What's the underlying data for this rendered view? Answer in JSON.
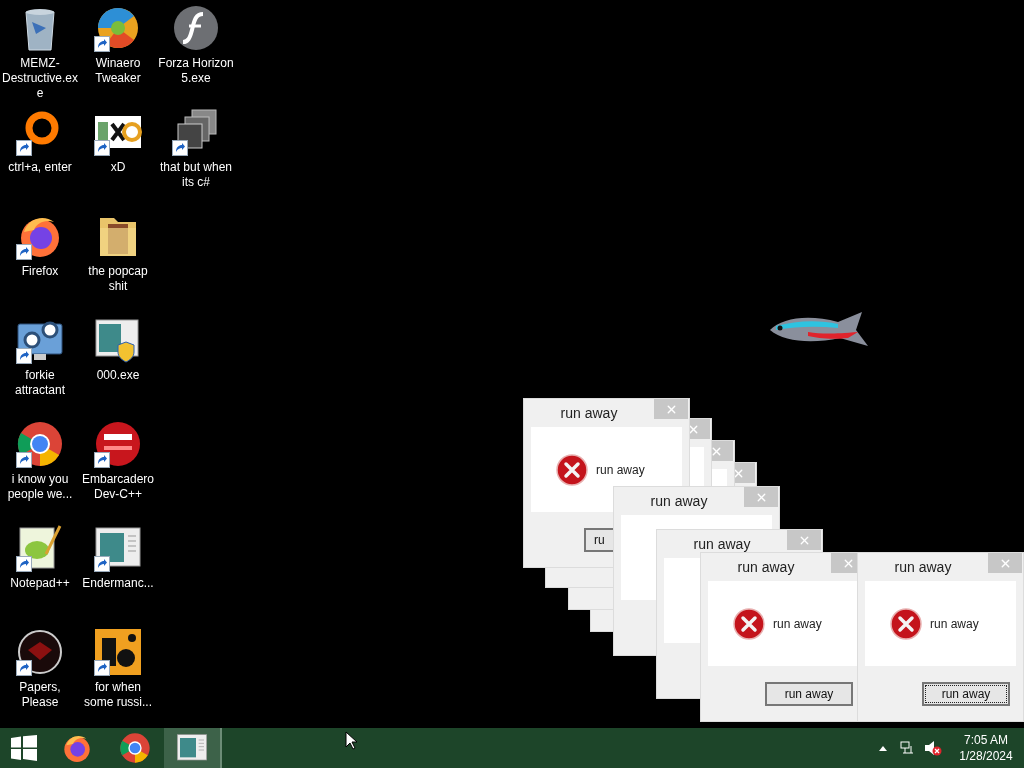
{
  "desktop": {
    "icon_rows": [
      [
        {
          "label": "MEMZ-Destructive.exe",
          "kind": "bin",
          "shortcut": false
        },
        {
          "label": "Winaero Tweaker",
          "kind": "swirl",
          "shortcut": true
        },
        {
          "label": "Forza Horizon 5.exe",
          "kind": "flash",
          "shortcut": false
        }
      ],
      [
        {
          "label": "ctrl+a, enter",
          "kind": "ring",
          "shortcut": true
        },
        {
          "label": "xD",
          "kind": "hxd",
          "shortcut": true
        },
        {
          "label": "that but when its c#",
          "kind": "stack",
          "shortcut": true
        }
      ],
      [
        {
          "label": "Firefox",
          "kind": "firefox",
          "shortcut": true
        },
        {
          "label": "the popcap shit",
          "kind": "folder",
          "shortcut": false
        }
      ],
      [
        {
          "label": "forkie attractant",
          "kind": "gears",
          "shortcut": true
        },
        {
          "label": "000.exe",
          "kind": "shieldwin",
          "shortcut": false
        }
      ],
      [
        {
          "label": "i know you people we...",
          "kind": "chrome",
          "shortcut": true
        },
        {
          "label": "Embarcadero Dev-C++",
          "kind": "dev",
          "shortcut": true
        }
      ],
      [
        {
          "label": "Notepad++",
          "kind": "notepad",
          "shortcut": true
        },
        {
          "label": "Endermanc...",
          "kind": "window",
          "shortcut": true
        }
      ],
      [
        {
          "label": "Papers, Please",
          "kind": "seal",
          "shortcut": true
        },
        {
          "label": "for when some russi...",
          "kind": "de",
          "shortcut": true
        }
      ]
    ]
  },
  "windows": [
    {
      "kind": "blank"
    },
    {
      "kind": "blank"
    },
    {
      "kind": "blank"
    },
    {
      "kind": "dialog",
      "title": "run away",
      "message": "run away",
      "button": "ru",
      "focused": false
    },
    {
      "kind": "titled",
      "title": "run away"
    },
    {
      "kind": "titled",
      "title": "run away"
    },
    {
      "kind": "dialog",
      "title": "run away",
      "message": "run away",
      "button": "run away",
      "focused": false
    },
    {
      "kind": "dialog",
      "title": "run away",
      "message": "run away",
      "button": "run away",
      "focused": true
    }
  ],
  "taskbar": {
    "apps": [
      {
        "kind": "firefox",
        "selected": false
      },
      {
        "kind": "chrome",
        "selected": false
      },
      {
        "kind": "window",
        "selected": true
      }
    ],
    "tray": {
      "muted": true
    },
    "clock": {
      "time": "7:05 AM",
      "date": "1/28/2024"
    }
  }
}
